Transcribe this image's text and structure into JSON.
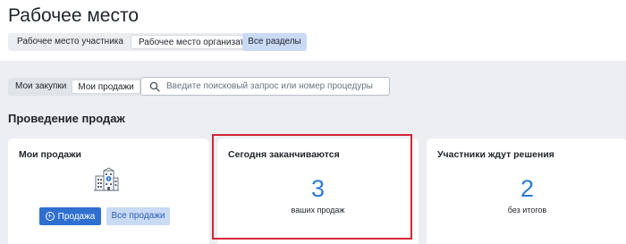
{
  "header": {
    "title": "Рабочее место",
    "workspace_tabs": [
      {
        "label": "Рабочее место участника",
        "active": false
      },
      {
        "label": "Рабочее место организатора",
        "active": true
      }
    ],
    "all_sections_label": "Все разделы"
  },
  "filters": {
    "mode_tabs": [
      {
        "label": "Мои закупки",
        "active": false
      },
      {
        "label": "Мои продажи",
        "active": true
      }
    ],
    "search": {
      "placeholder": "Введите поисковый запрос или номер процедуры",
      "value": "",
      "icon": "search-icon"
    }
  },
  "section": {
    "title": "Проведение продаж"
  },
  "cards": {
    "my_sales": {
      "title": "Мои продажи",
      "icon": "building-icon",
      "sale_button": "Продажа",
      "all_sales_button": "Все продажи"
    },
    "ending_today": {
      "title": "Сегодня заканчиваются",
      "count": "3",
      "caption": "ваших продаж"
    },
    "awaiting_decision": {
      "title": "Участники ждут решения",
      "count": "2",
      "caption": "без итогов"
    }
  },
  "colors": {
    "accent": "#2b7ad8",
    "primary_button": "#2f6fd0",
    "secondary_button": "#c9daf5",
    "highlight": "#d32632",
    "background": "#eceef1"
  }
}
